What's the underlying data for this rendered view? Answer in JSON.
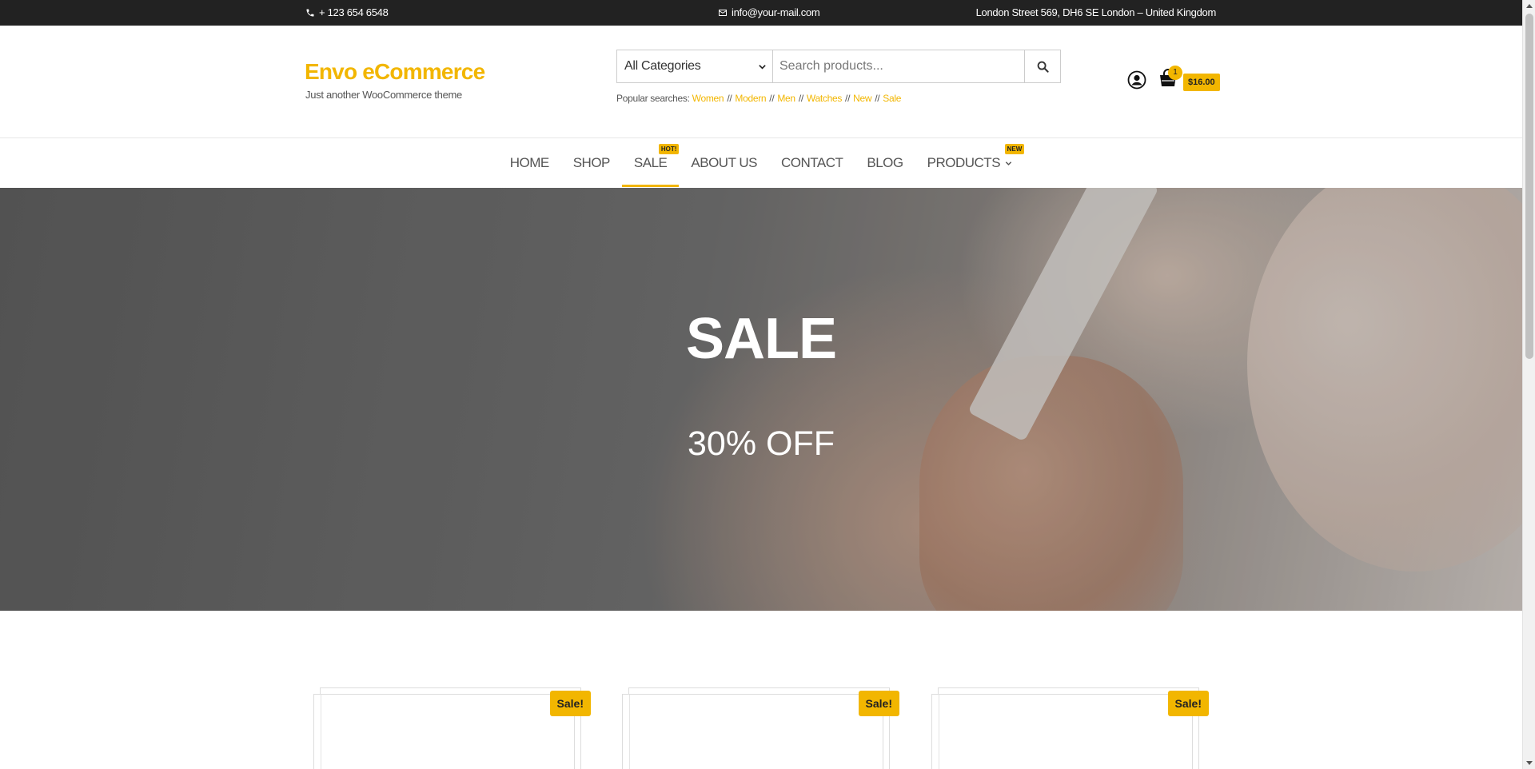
{
  "topbar": {
    "phone": "+ 123 654 6548",
    "email": "info@your-mail.com",
    "address": "London Street 569, DH6 SE London – United Kingdom"
  },
  "header": {
    "logo": "Envo eCommerce",
    "tagline": "Just another WooCommerce theme",
    "search": {
      "category": "All Categories",
      "placeholder": "Search products..."
    },
    "popular": {
      "label": "Popular searches:",
      "terms": [
        "Women",
        "Modern",
        "Men",
        "Watches",
        "New",
        "Sale"
      ],
      "separator": "//"
    },
    "cart": {
      "count": "1",
      "total": "$16.00"
    }
  },
  "nav": {
    "items": [
      {
        "label": "HOME"
      },
      {
        "label": "SHOP"
      },
      {
        "label": "SALE",
        "badge": "HOT!",
        "active": true
      },
      {
        "label": "ABOUT US"
      },
      {
        "label": "CONTACT"
      },
      {
        "label": "BLOG"
      },
      {
        "label": "PRODUCTS",
        "badge": "NEW",
        "dropdown": true
      }
    ]
  },
  "hero": {
    "title": "SALE",
    "subtitle": "30% OFF"
  },
  "products": {
    "sale_label": "Sale!"
  },
  "colors": {
    "accent": "#f2b600",
    "topbar": "#222222"
  }
}
